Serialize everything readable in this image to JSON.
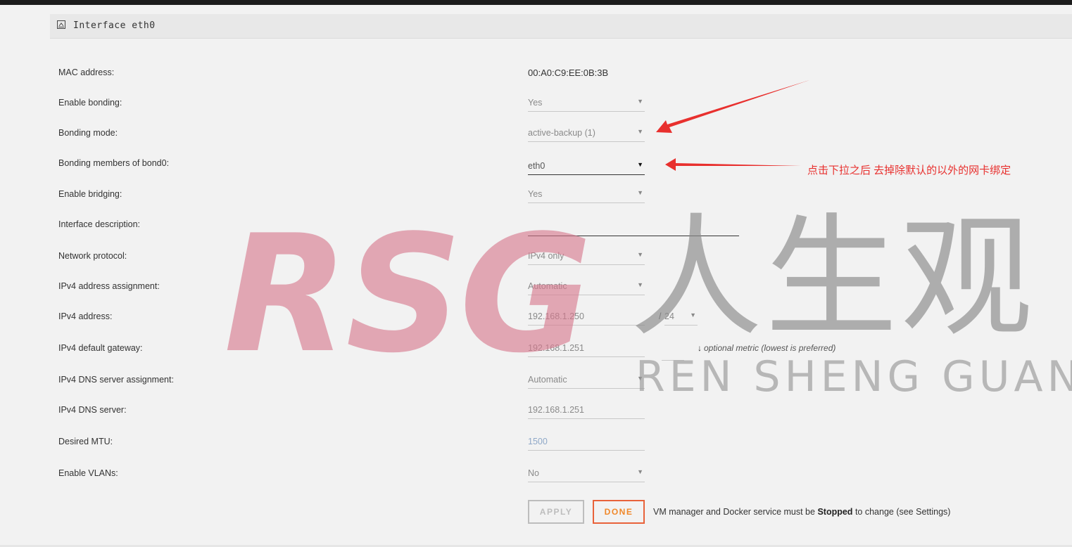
{
  "panel": {
    "title": "Interface eth0"
  },
  "fields": {
    "mac": {
      "label": "MAC address:",
      "value": "00:A0:C9:EE:0B:3B"
    },
    "enable_bonding": {
      "label": "Enable bonding:",
      "value": "Yes"
    },
    "bonding_mode": {
      "label": "Bonding mode:",
      "value": "active-backup (1)"
    },
    "bonding_members": {
      "label": "Bonding members of bond0:",
      "value": "eth0"
    },
    "enable_bridging": {
      "label": "Enable bridging:",
      "value": "Yes"
    },
    "interface_description": {
      "label": "Interface description:",
      "value": ""
    },
    "network_protocol": {
      "label": "Network protocol:",
      "value": "IPv4 only"
    },
    "ipv4_assignment": {
      "label": "IPv4 address assignment:",
      "value": "Automatic"
    },
    "ipv4_address": {
      "label": "IPv4 address:",
      "value": "192.168.1.250",
      "separator": "/",
      "prefix": "24"
    },
    "ipv4_gateway": {
      "label": "IPv4 default gateway:",
      "value": "192.168.1.251",
      "metric_icon": "↓",
      "metric_hint": "optional metric (lowest is preferred)"
    },
    "dns_assignment": {
      "label": "IPv4 DNS server assignment:",
      "value": "Automatic"
    },
    "dns_server": {
      "label": "IPv4 DNS server:",
      "value": "192.168.1.251"
    },
    "mtu": {
      "label": "Desired MTU:",
      "value": "1500"
    },
    "enable_vlans": {
      "label": "Enable VLANs:",
      "value": "No"
    }
  },
  "actions": {
    "apply": "APPLY",
    "done": "DONE",
    "note_prefix": "VM manager and Docker service must be",
    "note_bold": "Stopped",
    "note_suffix": "to change (see Settings)"
  },
  "annotation": {
    "text": "点击下拉之后  去掉除默认的以外的网卡绑定",
    "color": "#e8302e"
  },
  "watermark": {
    "logo": "RSG",
    "chinese": "人生观",
    "english": "REN SHENG GUAN"
  },
  "colors": {
    "accent_done": "#f0882a",
    "done_border": "#e8623a",
    "annotation": "#e8302e"
  }
}
